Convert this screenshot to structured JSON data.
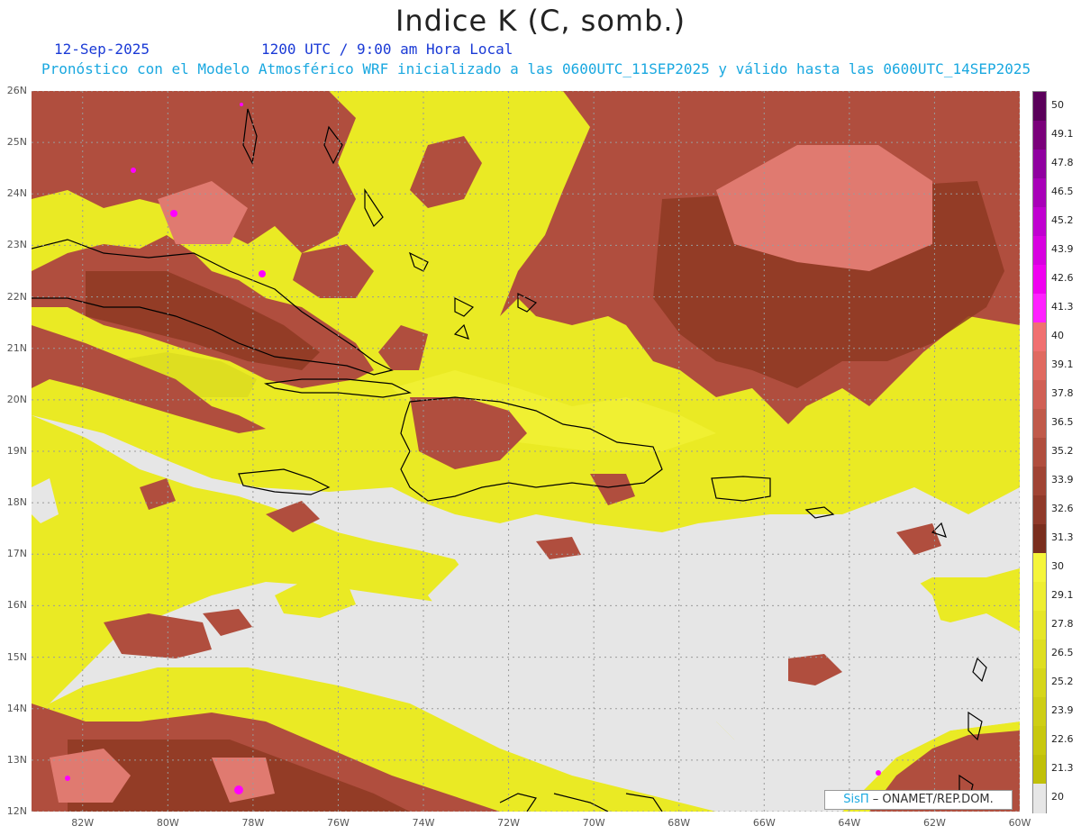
{
  "header": {
    "title": "Indice K (C, somb.)",
    "date": "12-Sep-2025",
    "time": "1200 UTC / 9:00 am Hora Local",
    "forecast": "Pronóstico con el Modelo Atmosférico WRF inicializado a las 0600UTC_11SEP2025 y válido hasta las  0600UTC_14SEP2025"
  },
  "map": {
    "lat_labels": [
      "26N",
      "25N",
      "24N",
      "23N",
      "22N",
      "21N",
      "20N",
      "19N",
      "18N",
      "17N",
      "16N",
      "15N",
      "14N",
      "13N",
      "12N"
    ],
    "lon_labels": [
      "82W",
      "80W",
      "78W",
      "76W",
      "74W",
      "72W",
      "70W",
      "68W",
      "66W",
      "64W",
      "62W",
      "60W"
    ],
    "lat_range": [
      12,
      26
    ],
    "lon_range": [
      -83.2,
      -60
    ],
    "gridlines": "dotted"
  },
  "colorbar": {
    "labels": [
      "50",
      "49.1",
      "47.8",
      "46.5",
      "45.2",
      "43.9",
      "42.6",
      "41.3",
      "40",
      "39.1",
      "37.8",
      "36.5",
      "35.2",
      "33.9",
      "32.6",
      "31.3",
      "30",
      "29.1",
      "27.8",
      "26.5",
      "25.2",
      "23.9",
      "22.6",
      "21.3",
      "20"
    ],
    "colors": {
      "none": "#e6e6e6",
      "low": "#c8c800",
      "mid": "#eaea20",
      "yellow_high": "#f5f53a",
      "brown": "#8a3a1e",
      "brown_mid": "#b05040",
      "salmon": "#d06a60",
      "pink": "#f08080",
      "magenta": "#ff00ff",
      "purple": "#6a006a"
    }
  },
  "credit": {
    "logo": "SisΠ",
    "text": " – ONAMET/REP.DOM."
  }
}
